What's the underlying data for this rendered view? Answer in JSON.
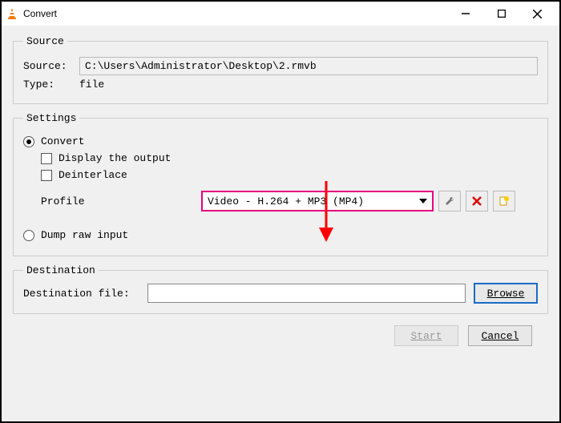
{
  "window": {
    "title": "Convert"
  },
  "source": {
    "legend": "Source",
    "source_label": "Source:",
    "source_value": "C:\\Users\\Administrator\\Desktop\\2.rmvb",
    "type_label": "Type:",
    "type_value": "file"
  },
  "settings": {
    "legend": "Settings",
    "convert_label": "Convert",
    "display_output_label": "Display the output",
    "deinterlace_label": "Deinterlace",
    "profile_label": "Profile",
    "profile_value": "Video - H.264 + MP3 (MP4)",
    "dump_raw_label": "Dump raw input"
  },
  "destination": {
    "legend": "Destination",
    "file_label": "Destination file:",
    "browse_label": "Browse"
  },
  "footer": {
    "start_label": "Start",
    "cancel_label": "Cancel"
  },
  "icons": {
    "wrench": "wrench-icon",
    "delete": "delete-icon",
    "new": "new-profile-icon"
  }
}
